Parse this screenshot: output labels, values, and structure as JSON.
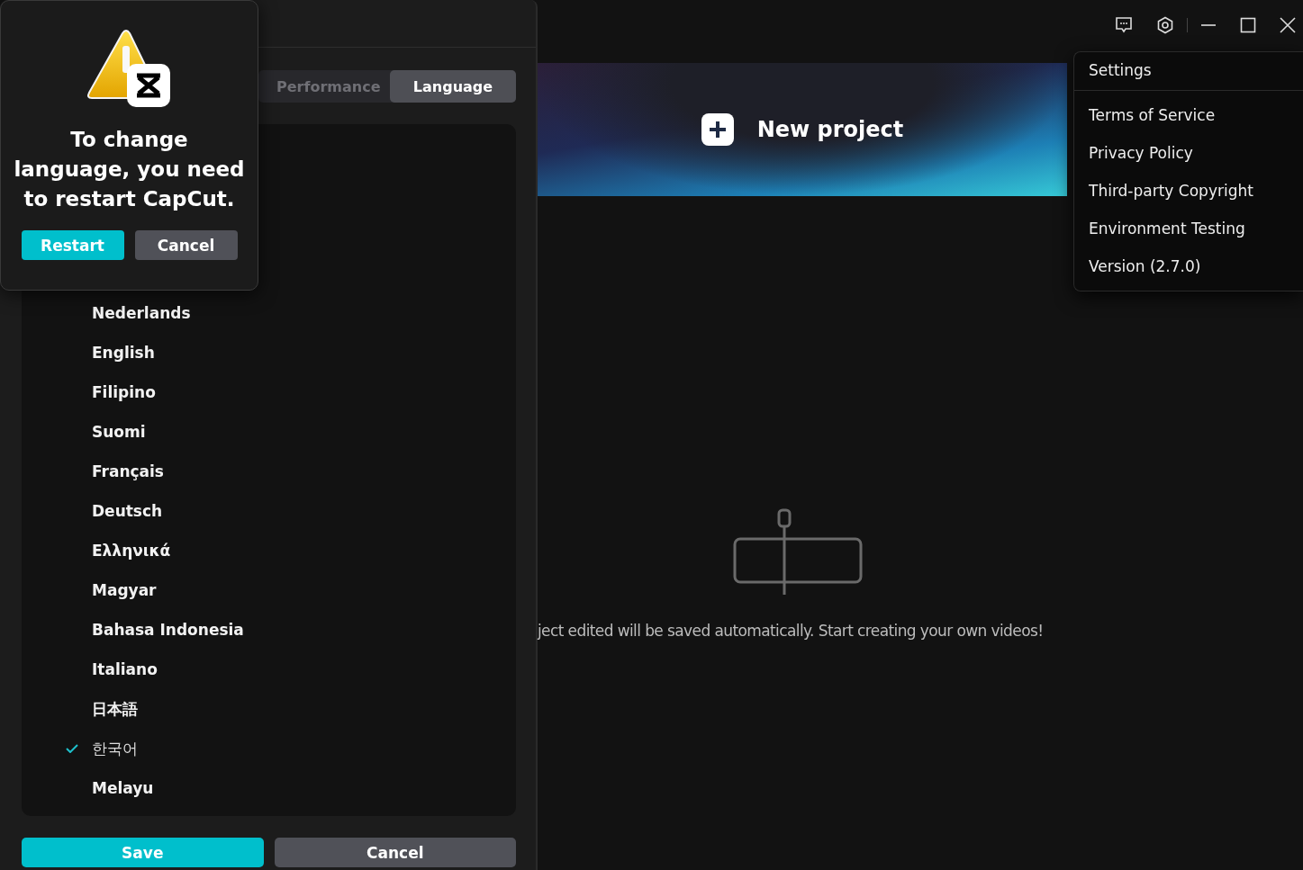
{
  "settings_dialog": {
    "tabs": [
      {
        "label": "Performance",
        "selected": false
      },
      {
        "label": "Language",
        "selected": true
      }
    ],
    "languages": [
      {
        "label": "Nederlands",
        "selected": false
      },
      {
        "label": "English",
        "selected": false
      },
      {
        "label": "Filipino",
        "selected": false
      },
      {
        "label": "Suomi",
        "selected": false
      },
      {
        "label": "Français",
        "selected": false
      },
      {
        "label": "Deutsch",
        "selected": false
      },
      {
        "label": "Ελληνικά",
        "selected": false
      },
      {
        "label": "Magyar",
        "selected": false
      },
      {
        "label": "Bahasa Indonesia",
        "selected": false
      },
      {
        "label": "Italiano",
        "selected": false
      },
      {
        "label": "日本語",
        "selected": false
      },
      {
        "label": "한국어",
        "selected": true
      },
      {
        "label": "Melayu",
        "selected": false
      }
    ],
    "buttons": {
      "save": "Save",
      "cancel": "Cancel"
    }
  },
  "restart_popup": {
    "message": "To change language, you need to restart CapCut.",
    "buttons": {
      "restart": "Restart",
      "cancel": "Cancel"
    }
  },
  "main": {
    "new_project": "New project",
    "empty_text": "ject edited will be saved automatically. Start creating your own videos!"
  },
  "menu": {
    "title": "Settings",
    "items": [
      "Terms of Service",
      "Privacy Policy",
      "Third-party Copyright",
      "Environment Testing",
      "Version (2.7.0)"
    ]
  }
}
